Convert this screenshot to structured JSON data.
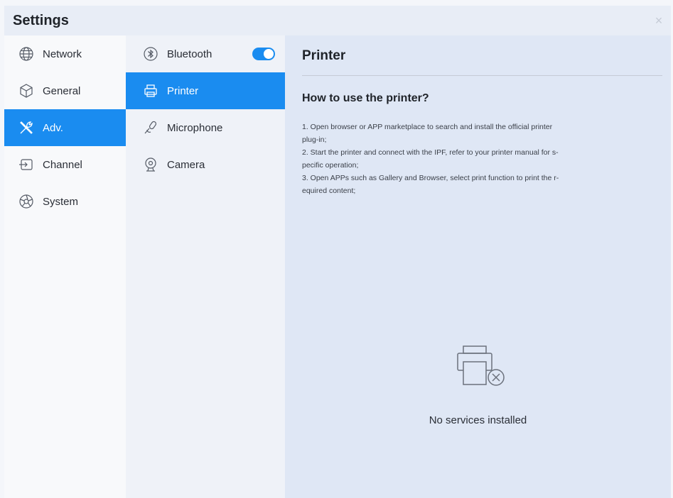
{
  "window": {
    "title": "Settings",
    "close_label": "×"
  },
  "nav_primary": [
    {
      "label": "Network",
      "icon": "globe-icon",
      "active": false
    },
    {
      "label": "General",
      "icon": "cube-icon",
      "active": false
    },
    {
      "label": "Adv.",
      "icon": "tools-icon",
      "active": true
    },
    {
      "label": "Channel",
      "icon": "input-icon",
      "active": false
    },
    {
      "label": "System",
      "icon": "aperture-icon",
      "active": false
    }
  ],
  "nav_secondary": [
    {
      "label": "Bluetooth",
      "icon": "bluetooth-icon",
      "active": false,
      "toggle_on": true
    },
    {
      "label": "Printer",
      "icon": "printer-icon",
      "active": true
    },
    {
      "label": "Microphone",
      "icon": "microphone-icon",
      "active": false
    },
    {
      "label": "Camera",
      "icon": "camera-icon",
      "active": false
    }
  ],
  "panel": {
    "title": "Printer",
    "how_title": "How to use the printer?",
    "steps": [
      "1. Open browser or APP marketplace to search and install the official printer",
      "plug-in;",
      "2. Start the printer and connect with the IPF, refer to your printer manual for s-",
      "pecific operation;",
      "3. Open APPs such as Gallery and Browser, select print function to print the r-",
      "equired content;"
    ],
    "empty_icon": "printer-unavailable-icon",
    "empty_text": "No services installed"
  },
  "colors": {
    "accent": "#1a8cf0",
    "panel_bg": "#dfe7f5"
  }
}
